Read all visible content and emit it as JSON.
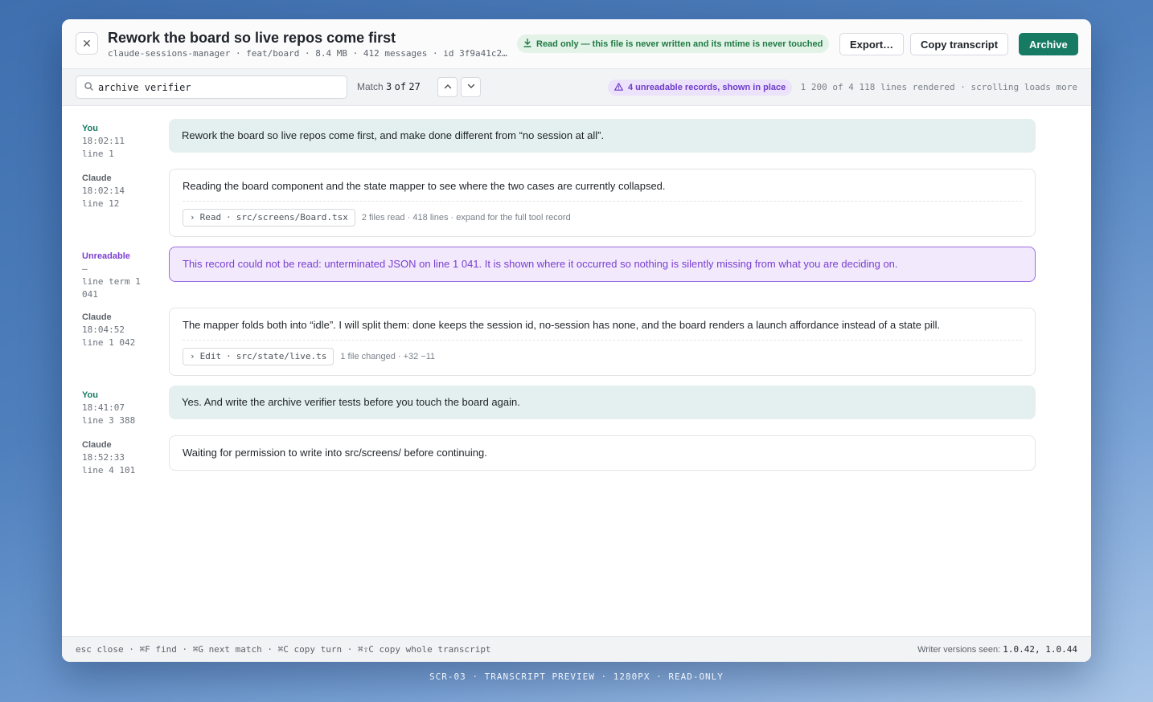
{
  "header": {
    "close_icon": "close-icon",
    "title": "Rework the board so live repos come first",
    "subtitle": "claude-sessions-manager · feat/board · 8.4 MB · 412 messages · id 3f9a41c2…",
    "readonly_icon": "download-icon",
    "readonly_text": "Read only — this file is never written and its mtime is never touched",
    "export_label": "Export…",
    "copy_label": "Copy transcript",
    "archive_label": "Archive",
    "colors": {
      "accent": "#177a63",
      "readonly_bg": "#e3f3e8",
      "readonly_fg": "#1f7a43"
    }
  },
  "search": {
    "value": "archive verifier",
    "match_label": "Match",
    "match_current": "3",
    "match_of": "of",
    "match_total": "27",
    "warning": "4 unreadable records, shown in place",
    "lines_info": "1 200 of 4 118 lines rendered · scrolling loads more",
    "colors": {
      "warning_bg": "#ece2fb",
      "warning_fg": "#6f3cc9"
    }
  },
  "turns": [
    {
      "who": "You",
      "time": "18:02:11",
      "line": "line 1",
      "kind": "you",
      "text": "Rework the board so live repos come first, and make done different from “no session at all”."
    },
    {
      "who": "Claude",
      "time": "18:02:14",
      "line": "line 12",
      "kind": "claude",
      "text": "Reading the board component and the state mapper to see where the two cases are currently collapsed.",
      "tool": {
        "chevron": "›",
        "name": "Read",
        "sep": "·",
        "path": "src/screens/Board.tsx",
        "note": "2 files read · 418 lines · expand for the full tool record"
      }
    },
    {
      "who": "Unreadable",
      "time": "–",
      "line": "line term 1 041",
      "kind": "unread",
      "text": "This record could not be read: unterminated JSON on line 1 041. It is shown where it occurred so nothing is silently missing from what you are deciding on."
    },
    {
      "who": "Claude",
      "time": "18:04:52",
      "line": "line 1 042",
      "kind": "claude",
      "text": "The mapper folds both into “idle”. I will split them: done keeps the session id, no-session has none, and the board renders a launch affordance instead of a state pill.",
      "tool": {
        "chevron": "›",
        "name": "Edit",
        "sep": "·",
        "path": "src/state/live.ts",
        "note": "1 file changed · +32 −11"
      }
    },
    {
      "who": "You",
      "time": "18:41:07",
      "line": "line 3 388",
      "kind": "you",
      "text": "Yes. And write the archive verifier tests before you touch the board again."
    },
    {
      "who": "Claude",
      "time": "18:52:33",
      "line": "line 4 101",
      "kind": "claude",
      "text": "Waiting for permission to write into src/screens/ before continuing."
    }
  ],
  "footer": {
    "shortcuts": "esc close · ⌘F find · ⌘G next match · ⌘C copy turn · ⌘⇧C copy whole transcript",
    "writer_label": "Writer versions seen:",
    "writer_versions": "1.0.42, 1.0.44"
  },
  "caption": "SCR-03 · TRANSCRIPT PREVIEW · 1280PX · READ-ONLY"
}
